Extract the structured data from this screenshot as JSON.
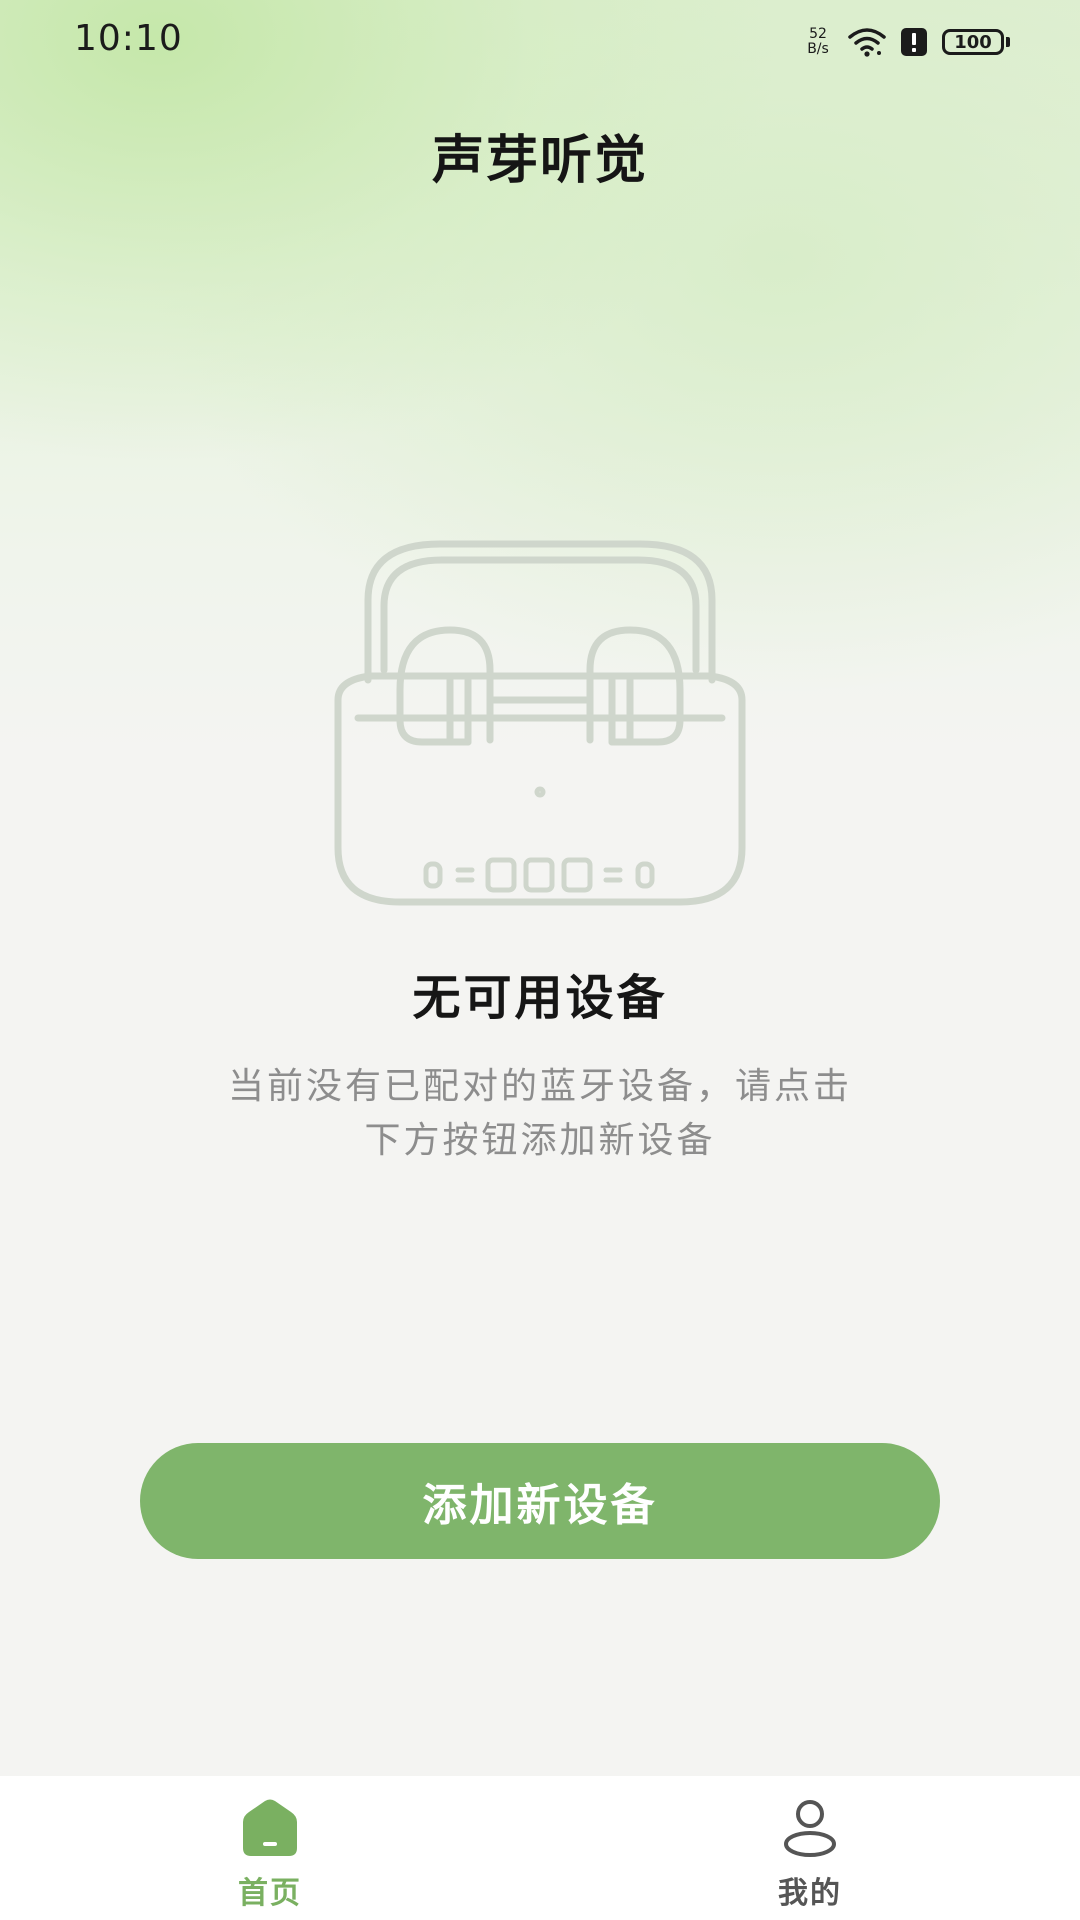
{
  "status_bar": {
    "time": "10:10",
    "net_speed_value": "52",
    "net_speed_unit": "B/s",
    "battery": "100",
    "icons": [
      "wifi-icon",
      "alert-icon",
      "battery-icon"
    ]
  },
  "header": {
    "title": "声芽听觉"
  },
  "empty_state": {
    "illustration": "earbuds-case-illustration",
    "title": "无可用设备",
    "description_line1": "当前没有已配对的蓝牙设备，请点击",
    "description_line2": "下方按钮添加新设备"
  },
  "actions": {
    "add_device_label": "添加新设备"
  },
  "tab_bar": {
    "tabs": [
      {
        "label": "首页",
        "icon": "home-icon",
        "active": true
      },
      {
        "label": "我的",
        "icon": "profile-icon",
        "active": false
      }
    ]
  },
  "colors": {
    "accent": "#7fb56b",
    "active_tab": "#7ab061",
    "inactive_tab": "#555555",
    "description_text": "#8d8d8d"
  }
}
